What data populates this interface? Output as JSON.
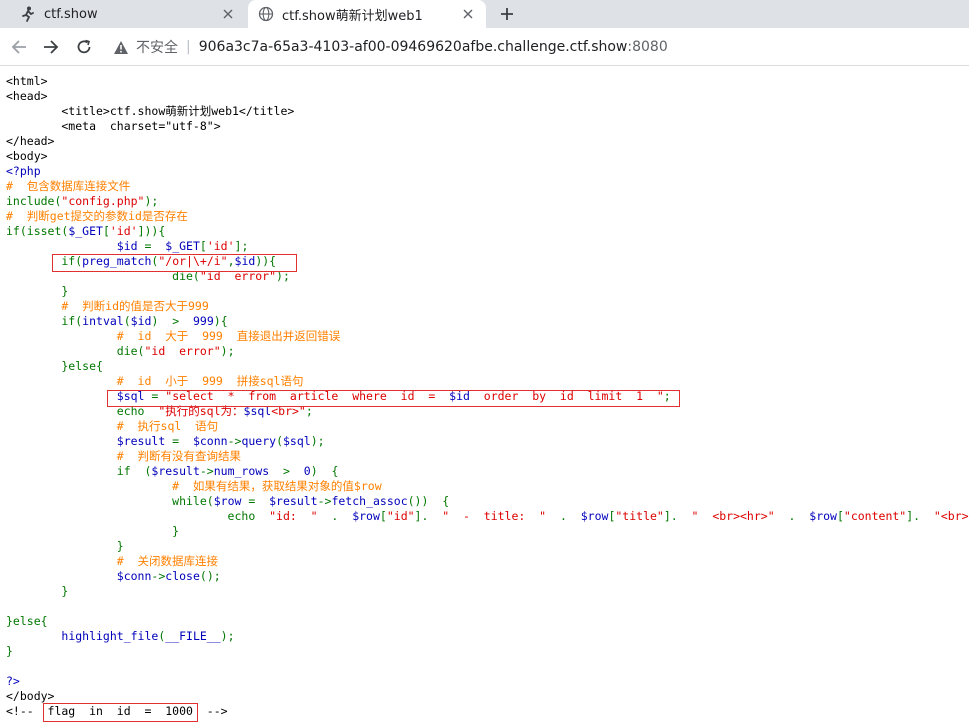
{
  "browser": {
    "tabs": [
      {
        "title": "ctf.show",
        "active": false,
        "icon": "ctfshow-runner-icon"
      },
      {
        "title": "ctf.show萌新计划web1",
        "active": true,
        "icon": "globe-icon"
      }
    ],
    "address": {
      "security_label": "不安全",
      "host": "906a3c7a-65a3-4103-af00-09469620afbe.challenge.ctf.show",
      "port": ":8080"
    }
  },
  "source_lines": [
    {
      "tokens": [
        {
          "t": "<html>",
          "c": "p"
        }
      ]
    },
    {
      "tokens": [
        {
          "t": "<head>",
          "c": "p"
        }
      ]
    },
    {
      "tokens": [
        {
          "t": "        <title>ctf.show萌新计划web1</title>",
          "c": "p"
        }
      ]
    },
    {
      "tokens": [
        {
          "t": "        <meta  charset=\"utf-8\">",
          "c": "p"
        }
      ]
    },
    {
      "tokens": [
        {
          "t": "</head>",
          "c": "p"
        }
      ]
    },
    {
      "tokens": [
        {
          "t": "<body>",
          "c": "p"
        }
      ]
    },
    {
      "tokens": [
        {
          "t": "<?php",
          "c": "v"
        }
      ]
    },
    {
      "tokens": [
        {
          "t": "#  包含数据库连接文件",
          "c": "c"
        }
      ]
    },
    {
      "tokens": [
        {
          "t": "include(",
          "c": "k"
        },
        {
          "t": "\"config.php\"",
          "c": "s"
        },
        {
          "t": ");",
          "c": "k"
        }
      ]
    },
    {
      "tokens": [
        {
          "t": "#  判断get提交的参数id是否存在",
          "c": "c"
        }
      ]
    },
    {
      "tokens": [
        {
          "t": "if(isset(",
          "c": "k"
        },
        {
          "t": "$_GET",
          "c": "v"
        },
        {
          "t": "[",
          "c": "k"
        },
        {
          "t": "'id'",
          "c": "s"
        },
        {
          "t": "])){",
          "c": "k"
        }
      ]
    },
    {
      "tokens": [
        {
          "t": "                ",
          "c": "k"
        },
        {
          "t": "$id ",
          "c": "v"
        },
        {
          "t": "= ",
          "c": "k"
        },
        {
          "t": " $_GET",
          "c": "v"
        },
        {
          "t": "[",
          "c": "k"
        },
        {
          "t": "'id'",
          "c": "s"
        },
        {
          "t": "];",
          "c": "k"
        }
      ]
    },
    {
      "tokens": [
        {
          "t": "        if(",
          "c": "k"
        },
        {
          "t": "preg_match",
          "c": "v"
        },
        {
          "t": "(",
          "c": "k"
        },
        {
          "t": "\"/or|\\+/i\"",
          "c": "s"
        },
        {
          "t": ",",
          "c": "k"
        },
        {
          "t": "$id",
          "c": "v"
        },
        {
          "t": ")){",
          "c": "k"
        }
      ]
    },
    {
      "tokens": [
        {
          "t": "                        die(",
          "c": "k"
        },
        {
          "t": "\"id  error\"",
          "c": "s"
        },
        {
          "t": ");",
          "c": "k"
        }
      ]
    },
    {
      "tokens": [
        {
          "t": "        }",
          "c": "k"
        }
      ]
    },
    {
      "tokens": [
        {
          "t": "        #  判断id的值是否大于999",
          "c": "c"
        }
      ]
    },
    {
      "tokens": [
        {
          "t": "        if(",
          "c": "k"
        },
        {
          "t": "intval",
          "c": "v"
        },
        {
          "t": "(",
          "c": "k"
        },
        {
          "t": "$id",
          "c": "v"
        },
        {
          "t": ")  >  ",
          "c": "k"
        },
        {
          "t": "999",
          "c": "v"
        },
        {
          "t": "){",
          "c": "k"
        }
      ]
    },
    {
      "tokens": [
        {
          "t": "                #  id  大于  999  直接退出并返回错误",
          "c": "c"
        }
      ]
    },
    {
      "tokens": [
        {
          "t": "                die(",
          "c": "k"
        },
        {
          "t": "\"id  error\"",
          "c": "s"
        },
        {
          "t": ");",
          "c": "k"
        }
      ]
    },
    {
      "tokens": [
        {
          "t": "        }else{",
          "c": "k"
        }
      ]
    },
    {
      "tokens": [
        {
          "t": "                #  id  小于  999  拼接sql语句",
          "c": "c"
        }
      ]
    },
    {
      "tokens": [
        {
          "t": "                ",
          "c": "k"
        },
        {
          "t": "$sql ",
          "c": "v"
        },
        {
          "t": "= ",
          "c": "k"
        },
        {
          "t": "\"select  *  from  article  where  id  =  ",
          "c": "s"
        },
        {
          "t": "$id",
          "c": "v"
        },
        {
          "t": "  order  by  id  limit  1  \"",
          "c": "s"
        },
        {
          "t": ";",
          "c": "k"
        }
      ]
    },
    {
      "tokens": [
        {
          "t": "                echo ",
          "c": "k"
        },
        {
          "t": " \"执行的sql为：",
          "c": "s"
        },
        {
          "t": "$sql",
          "c": "v"
        },
        {
          "t": "<br>\"",
          "c": "s"
        },
        {
          "t": ";",
          "c": "k"
        }
      ]
    },
    {
      "tokens": [
        {
          "t": "                #  执行sql  语句",
          "c": "c"
        }
      ]
    },
    {
      "tokens": [
        {
          "t": "                ",
          "c": "k"
        },
        {
          "t": "$result ",
          "c": "v"
        },
        {
          "t": "= ",
          "c": "k"
        },
        {
          "t": " $conn",
          "c": "v"
        },
        {
          "t": "->",
          "c": "k"
        },
        {
          "t": "query",
          "c": "v"
        },
        {
          "t": "(",
          "c": "k"
        },
        {
          "t": "$sql",
          "c": "v"
        },
        {
          "t": ");",
          "c": "k"
        }
      ]
    },
    {
      "tokens": [
        {
          "t": "                #  判断有没有查询结果",
          "c": "c"
        }
      ]
    },
    {
      "tokens": [
        {
          "t": "                if  (",
          "c": "k"
        },
        {
          "t": "$result",
          "c": "v"
        },
        {
          "t": "->",
          "c": "k"
        },
        {
          "t": "num_rows ",
          "c": "v"
        },
        {
          "t": " >  ",
          "c": "k"
        },
        {
          "t": "0",
          "c": "v"
        },
        {
          "t": ")  {",
          "c": "k"
        }
      ]
    },
    {
      "tokens": [
        {
          "t": "                        #  如果有结果，获取结果对象的值$row",
          "c": "c"
        }
      ]
    },
    {
      "tokens": [
        {
          "t": "                        while(",
          "c": "k"
        },
        {
          "t": "$row ",
          "c": "v"
        },
        {
          "t": "= ",
          "c": "k"
        },
        {
          "t": " $result",
          "c": "v"
        },
        {
          "t": "->",
          "c": "k"
        },
        {
          "t": "fetch_assoc",
          "c": "v"
        },
        {
          "t": "())  {",
          "c": "k"
        }
      ]
    },
    {
      "tokens": [
        {
          "t": "                                echo ",
          "c": "k"
        },
        {
          "t": " \"id:  \" ",
          "c": "s"
        },
        {
          "t": " .  ",
          "c": "k"
        },
        {
          "t": "$row",
          "c": "v"
        },
        {
          "t": "[",
          "c": "k"
        },
        {
          "t": "\"id\"",
          "c": "s"
        },
        {
          "t": "].  ",
          "c": "k"
        },
        {
          "t": "\"  -  title:  \" ",
          "c": "s"
        },
        {
          "t": " .  ",
          "c": "k"
        },
        {
          "t": "$row",
          "c": "v"
        },
        {
          "t": "[",
          "c": "k"
        },
        {
          "t": "\"title\"",
          "c": "s"
        },
        {
          "t": "].  ",
          "c": "k"
        },
        {
          "t": "\"  <br><hr>\" ",
          "c": "s"
        },
        {
          "t": " .  ",
          "c": "k"
        },
        {
          "t": "$row",
          "c": "v"
        },
        {
          "t": "[",
          "c": "k"
        },
        {
          "t": "\"content\"",
          "c": "s"
        },
        {
          "t": "].  ",
          "c": "k"
        },
        {
          "t": "\"<br>\"",
          "c": "s"
        },
        {
          "t": ";",
          "c": "k"
        }
      ]
    },
    {
      "tokens": [
        {
          "t": "                        }",
          "c": "k"
        }
      ]
    },
    {
      "tokens": [
        {
          "t": "                }",
          "c": "k"
        }
      ]
    },
    {
      "tokens": [
        {
          "t": "                #  关闭数据库连接",
          "c": "c"
        }
      ]
    },
    {
      "tokens": [
        {
          "t": "                ",
          "c": "k"
        },
        {
          "t": "$conn",
          "c": "v"
        },
        {
          "t": "->",
          "c": "k"
        },
        {
          "t": "close",
          "c": "v"
        },
        {
          "t": "();",
          "c": "k"
        }
      ]
    },
    {
      "tokens": [
        {
          "t": "        }",
          "c": "k"
        }
      ]
    },
    {
      "tokens": [
        {
          "t": "",
          "c": "k"
        }
      ]
    },
    {
      "tokens": [
        {
          "t": "}else{",
          "c": "k"
        }
      ]
    },
    {
      "tokens": [
        {
          "t": "        ",
          "c": "k"
        },
        {
          "t": "highlight_file",
          "c": "v"
        },
        {
          "t": "(",
          "c": "k"
        },
        {
          "t": "__FILE__",
          "c": "v"
        },
        {
          "t": ");",
          "c": "k"
        }
      ]
    },
    {
      "tokens": [
        {
          "t": "}",
          "c": "k"
        }
      ]
    },
    {
      "tokens": [
        {
          "t": "",
          "c": "k"
        }
      ]
    },
    {
      "tokens": [
        {
          "t": "?>",
          "c": "v"
        }
      ]
    },
    {
      "tokens": [
        {
          "t": "</body>",
          "c": "p"
        }
      ]
    },
    {
      "tokens": [
        {
          "t": "<!--  flag  in  id  =  1000  -->",
          "c": "p"
        }
      ]
    }
  ]
}
